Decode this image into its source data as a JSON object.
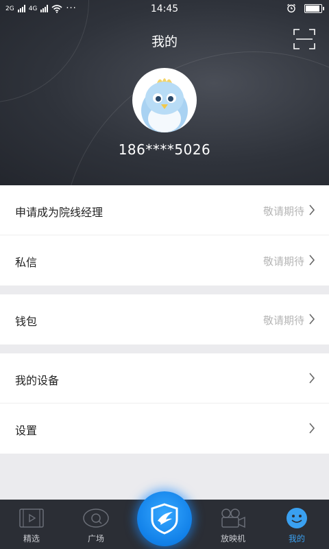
{
  "status_bar": {
    "network_1": "2G",
    "network_2": "4G",
    "more": "···",
    "time": "14:45",
    "battery_level_percent": 90
  },
  "header": {
    "title": "我的",
    "scan_icon": "scan-icon",
    "phone": "186****5026"
  },
  "menu_groups": [
    {
      "items": [
        {
          "label": "申请成为院线经理",
          "status": "敬请期待"
        },
        {
          "label": "私信",
          "status": "敬请期待"
        }
      ]
    },
    {
      "items": [
        {
          "label": "钱包",
          "status": "敬请期待"
        }
      ]
    },
    {
      "items": [
        {
          "label": "我的设备",
          "status": ""
        },
        {
          "label": "设置",
          "status": ""
        }
      ]
    }
  ],
  "tabbar": {
    "tabs": [
      {
        "label": "精选",
        "icon": "film-icon"
      },
      {
        "label": "广场",
        "icon": "plaza-icon"
      },
      {
        "label": "放映机",
        "icon": "projector-icon"
      },
      {
        "label": "我的",
        "icon": "smiley-icon",
        "active": true
      }
    ],
    "center_icon": "app-logo-icon"
  },
  "colors": {
    "accent": "#1a8cf0",
    "header_bg": "#2f333b",
    "tabbar_bg": "#2b2e35",
    "muted_text": "#b5b5b5"
  }
}
